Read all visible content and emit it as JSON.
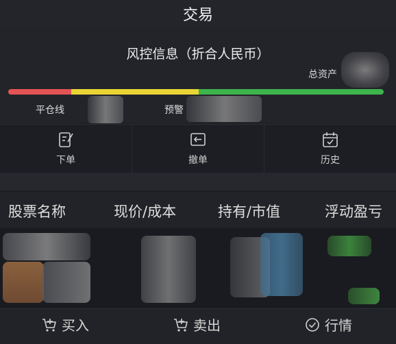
{
  "header": {
    "title": "交易"
  },
  "risk": {
    "title": "风控信息（折合人民币）",
    "total_assets_label": "总资产",
    "liquidation_label": "平仓线",
    "warning_label": "预警",
    "colors": {
      "red": "#e55454",
      "yellow": "#e8d534",
      "green": "#3db44c"
    }
  },
  "actions": [
    {
      "label": "下单",
      "icon": "order-icon"
    },
    {
      "label": "撤单",
      "icon": "cancel-order-icon"
    },
    {
      "label": "历史",
      "icon": "calendar-history-icon"
    }
  ],
  "holdings": {
    "columns": [
      "股票名称",
      "现价/成本",
      "持有/市值",
      "浮动盈亏"
    ]
  },
  "bottom_nav": [
    {
      "label": "买入",
      "icon": "cart-buy-icon"
    },
    {
      "label": "卖出",
      "icon": "cart-sell-icon"
    },
    {
      "label": "行情",
      "icon": "check-circle-icon"
    }
  ]
}
